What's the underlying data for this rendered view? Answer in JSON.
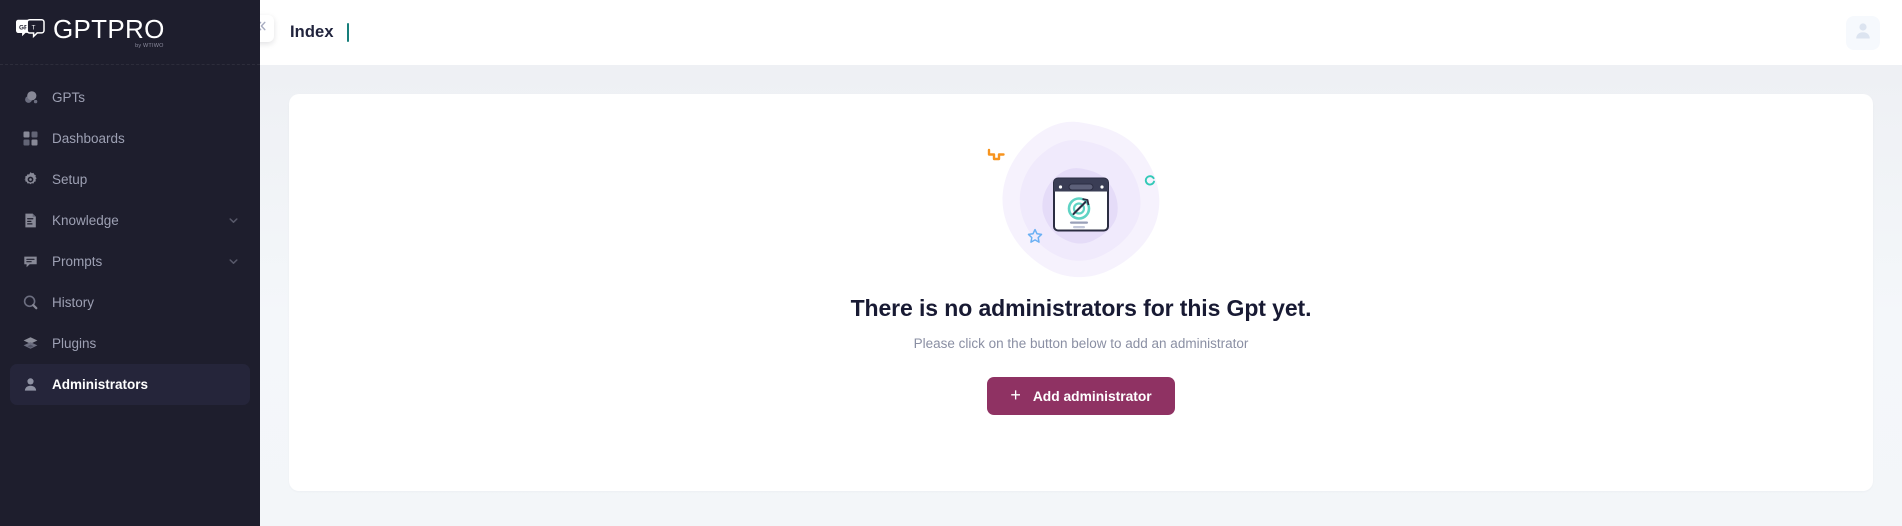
{
  "brand": {
    "title": "GPTPRO",
    "subtitle": "by WTIWO",
    "logo_icon": "chat-bubbles-gpt-logo-icon"
  },
  "sidebar": {
    "items": [
      {
        "id": "gpts",
        "label": "GPTs",
        "icon": "gpts-bubbles-icon",
        "active": false,
        "chevron": false
      },
      {
        "id": "dashboards",
        "label": "Dashboards",
        "icon": "grid-squares-icon",
        "active": false,
        "chevron": false
      },
      {
        "id": "setup",
        "label": "Setup",
        "icon": "gear-icon",
        "active": false,
        "chevron": false
      },
      {
        "id": "knowledge",
        "label": "Knowledge",
        "icon": "document-lines-icon",
        "active": false,
        "chevron": true
      },
      {
        "id": "prompts",
        "label": "Prompts",
        "icon": "chat-message-icon",
        "active": false,
        "chevron": true
      },
      {
        "id": "history",
        "label": "History",
        "icon": "search-icon",
        "active": false,
        "chevron": false
      },
      {
        "id": "plugins",
        "label": "Plugins",
        "icon": "layers-stack-icon",
        "active": false,
        "chevron": false
      },
      {
        "id": "administrators",
        "label": "Administrators",
        "icon": "person-icon",
        "active": true,
        "chevron": false
      }
    ]
  },
  "topbar": {
    "collapse_icon": "chevron-double-left-icon",
    "title": "Index",
    "divider_color": "#167e7a",
    "avatar_icon": "user-avatar-icon"
  },
  "empty_state": {
    "illustration_icon": "browser-window-target-check-icon",
    "decorations": [
      "orange-zigzag-arrow-icon",
      "teal-spinner-arc-icon",
      "blue-star-outline-icon"
    ],
    "title": "There is no administrators for this Gpt yet.",
    "subtitle": "Please click on the button below to add an administrator",
    "button": {
      "label": "Add administrator",
      "icon": "plus-icon",
      "color": "#8f3263"
    }
  },
  "colors": {
    "sidebar_bg": "#1e1e2d",
    "sidebar_active_bg": "#25253a",
    "content_bg": "#f2f4f7",
    "card_bg": "#ffffff",
    "accent_teal": "#167e7a",
    "accent_magenta": "#8f3263",
    "illustration_purple": "#efeafb",
    "decoration_orange": "#f7941e",
    "decoration_blue": "#6ab0f3"
  }
}
